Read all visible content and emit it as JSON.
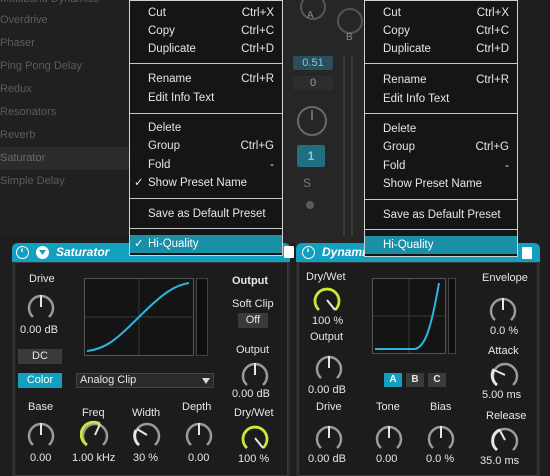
{
  "browser": {
    "items": [
      {
        "label": "Multiband Dynamics"
      },
      {
        "label": "Overdrive"
      },
      {
        "label": "Phaser"
      },
      {
        "label": "Ping Pong Delay"
      },
      {
        "label": "Redux"
      },
      {
        "label": "Resonators"
      },
      {
        "label": "Reverb"
      },
      {
        "label": "Saturator",
        "selected": true
      },
      {
        "label": "Simple Delay"
      }
    ]
  },
  "mixer": {
    "letter_a": "A",
    "letter_b": "B",
    "value_blue": "0.51",
    "value_gray": "0",
    "track_number": "1",
    "solo": "S"
  },
  "context_menu_left": {
    "items": [
      {
        "label": "Cut",
        "shortcut": "Ctrl+X"
      },
      {
        "label": "Copy",
        "shortcut": "Ctrl+C"
      },
      {
        "label": "Duplicate",
        "shortcut": "Ctrl+D"
      },
      {
        "label": "Rename",
        "shortcut": "Ctrl+R"
      },
      {
        "label": "Edit Info Text",
        "shortcut": ""
      },
      {
        "label": "Delete",
        "shortcut": ""
      },
      {
        "label": "Group",
        "shortcut": "Ctrl+G"
      },
      {
        "label": "Fold",
        "shortcut": "-"
      },
      {
        "label": "Show Preset Name",
        "shortcut": "",
        "checked": true
      },
      {
        "label": "Save as Default Preset",
        "shortcut": ""
      },
      {
        "label": "Hi-Quality",
        "shortcut": "",
        "checked": true,
        "highlighted": true
      }
    ]
  },
  "context_menu_right": {
    "items": [
      {
        "label": "Cut",
        "shortcut": "Ctrl+X"
      },
      {
        "label": "Copy",
        "shortcut": "Ctrl+C"
      },
      {
        "label": "Duplicate",
        "shortcut": "Ctrl+D"
      },
      {
        "label": "Rename",
        "shortcut": "Ctrl+R"
      },
      {
        "label": "Edit Info Text",
        "shortcut": ""
      },
      {
        "label": "Delete",
        "shortcut": ""
      },
      {
        "label": "Group",
        "shortcut": "Ctrl+G"
      },
      {
        "label": "Fold",
        "shortcut": "-"
      },
      {
        "label": "Show Preset Name",
        "shortcut": ""
      },
      {
        "label": "Save as Default Preset",
        "shortcut": ""
      },
      {
        "label": "Hi-Quality",
        "shortcut": "",
        "highlighted": true
      }
    ]
  },
  "saturator": {
    "title": "Saturator",
    "drive": {
      "label": "Drive",
      "value": "0.00 dB"
    },
    "dc_label": "DC",
    "color_label": "Color",
    "mode": "Analog Clip",
    "output_section": "Output",
    "soft_clip": {
      "label": "Soft Clip",
      "value": "Off"
    },
    "output": {
      "label": "Output",
      "value": "0.00 dB"
    },
    "drywet": {
      "label": "Dry/Wet",
      "value": "100 %",
      "level": 1.0
    },
    "base": {
      "label": "Base",
      "value": "0.00"
    },
    "freq": {
      "label": "Freq",
      "value": "1.00 kHz"
    },
    "width": {
      "label": "Width",
      "value": "30 %"
    },
    "depth": {
      "label": "Depth",
      "value": "0.00"
    }
  },
  "dynamic_tube": {
    "title": "Dynamic Tube",
    "drywet": {
      "label": "Dry/Wet",
      "value": "100 %",
      "level": 1.0
    },
    "output": {
      "label": "Output",
      "value": "0.00 dB"
    },
    "drive": {
      "label": "Drive",
      "value": "0.00 dB"
    },
    "tone": {
      "label": "Tone",
      "value": "0.00"
    },
    "bias": {
      "label": "Bias",
      "value": "0.0 %"
    },
    "tube_a": "A",
    "tube_b": "B",
    "tube_c": "C",
    "envelope": {
      "label": "Envelope",
      "value": "0.0 %"
    },
    "attack": {
      "label": "Attack",
      "value": "5.00 ms"
    },
    "release": {
      "label": "Release",
      "value": "35.0 ms"
    }
  },
  "colors": {
    "accent": "#12a0c0",
    "knob_active": "#c8e83a",
    "curve": "#2fb4e0"
  },
  "icons": [
    "power-icon",
    "fold-arrow-icon",
    "save-preset-icon",
    "checkmark-icon"
  ]
}
